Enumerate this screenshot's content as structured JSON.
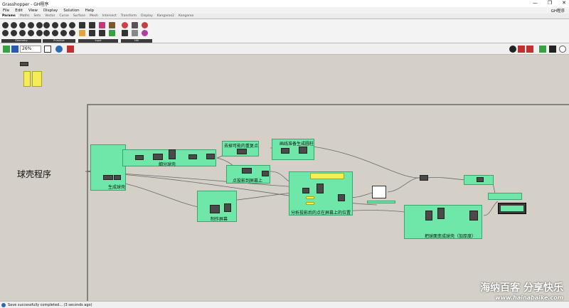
{
  "window": {
    "title": "Grasshopper - GH程序",
    "btn_min": "—",
    "btn_max": "❐",
    "btn_close": "✕"
  },
  "menu": {
    "items": [
      "File",
      "Edit",
      "View",
      "Display",
      "Solution",
      "Help"
    ],
    "doc_name": "GH程序"
  },
  "tabs": [
    "Params",
    "Maths",
    "Sets",
    "Vector",
    "Curve",
    "Surface",
    "Mesh",
    "Intersect",
    "Transform",
    "Display",
    "Kangaroo2",
    "Kangaroo"
  ],
  "ribbon_groups": [
    "Geometry",
    "Primitive",
    "Input",
    "Util"
  ],
  "toolbar": {
    "zoom": "26%"
  },
  "canvas": {
    "program_title": "球壳程序",
    "groups": {
      "divide_shell": "细分球壳",
      "generate_shell": "生成球壳",
      "remove_duplicates": "去掉可能的重复点",
      "curve_prep": "画线准备生成圆柱",
      "project_points": "点投影到屏幕上",
      "make_screen": "制作屏幕",
      "analyze_position": "分析投影后的点在屏幕上的位置",
      "shell_transform": "把球面变成球壳（加厚度）"
    }
  },
  "status": {
    "text": "Save successfully completed... (3 seconds ago)"
  },
  "watermark": {
    "text": "海纳百客 分享快乐",
    "url": "www.hainabaike.com"
  },
  "colors": {
    "group_green": "#6ee7a8",
    "panel_yellow": "#f5ec5a",
    "wire": "#6a6a6a"
  }
}
